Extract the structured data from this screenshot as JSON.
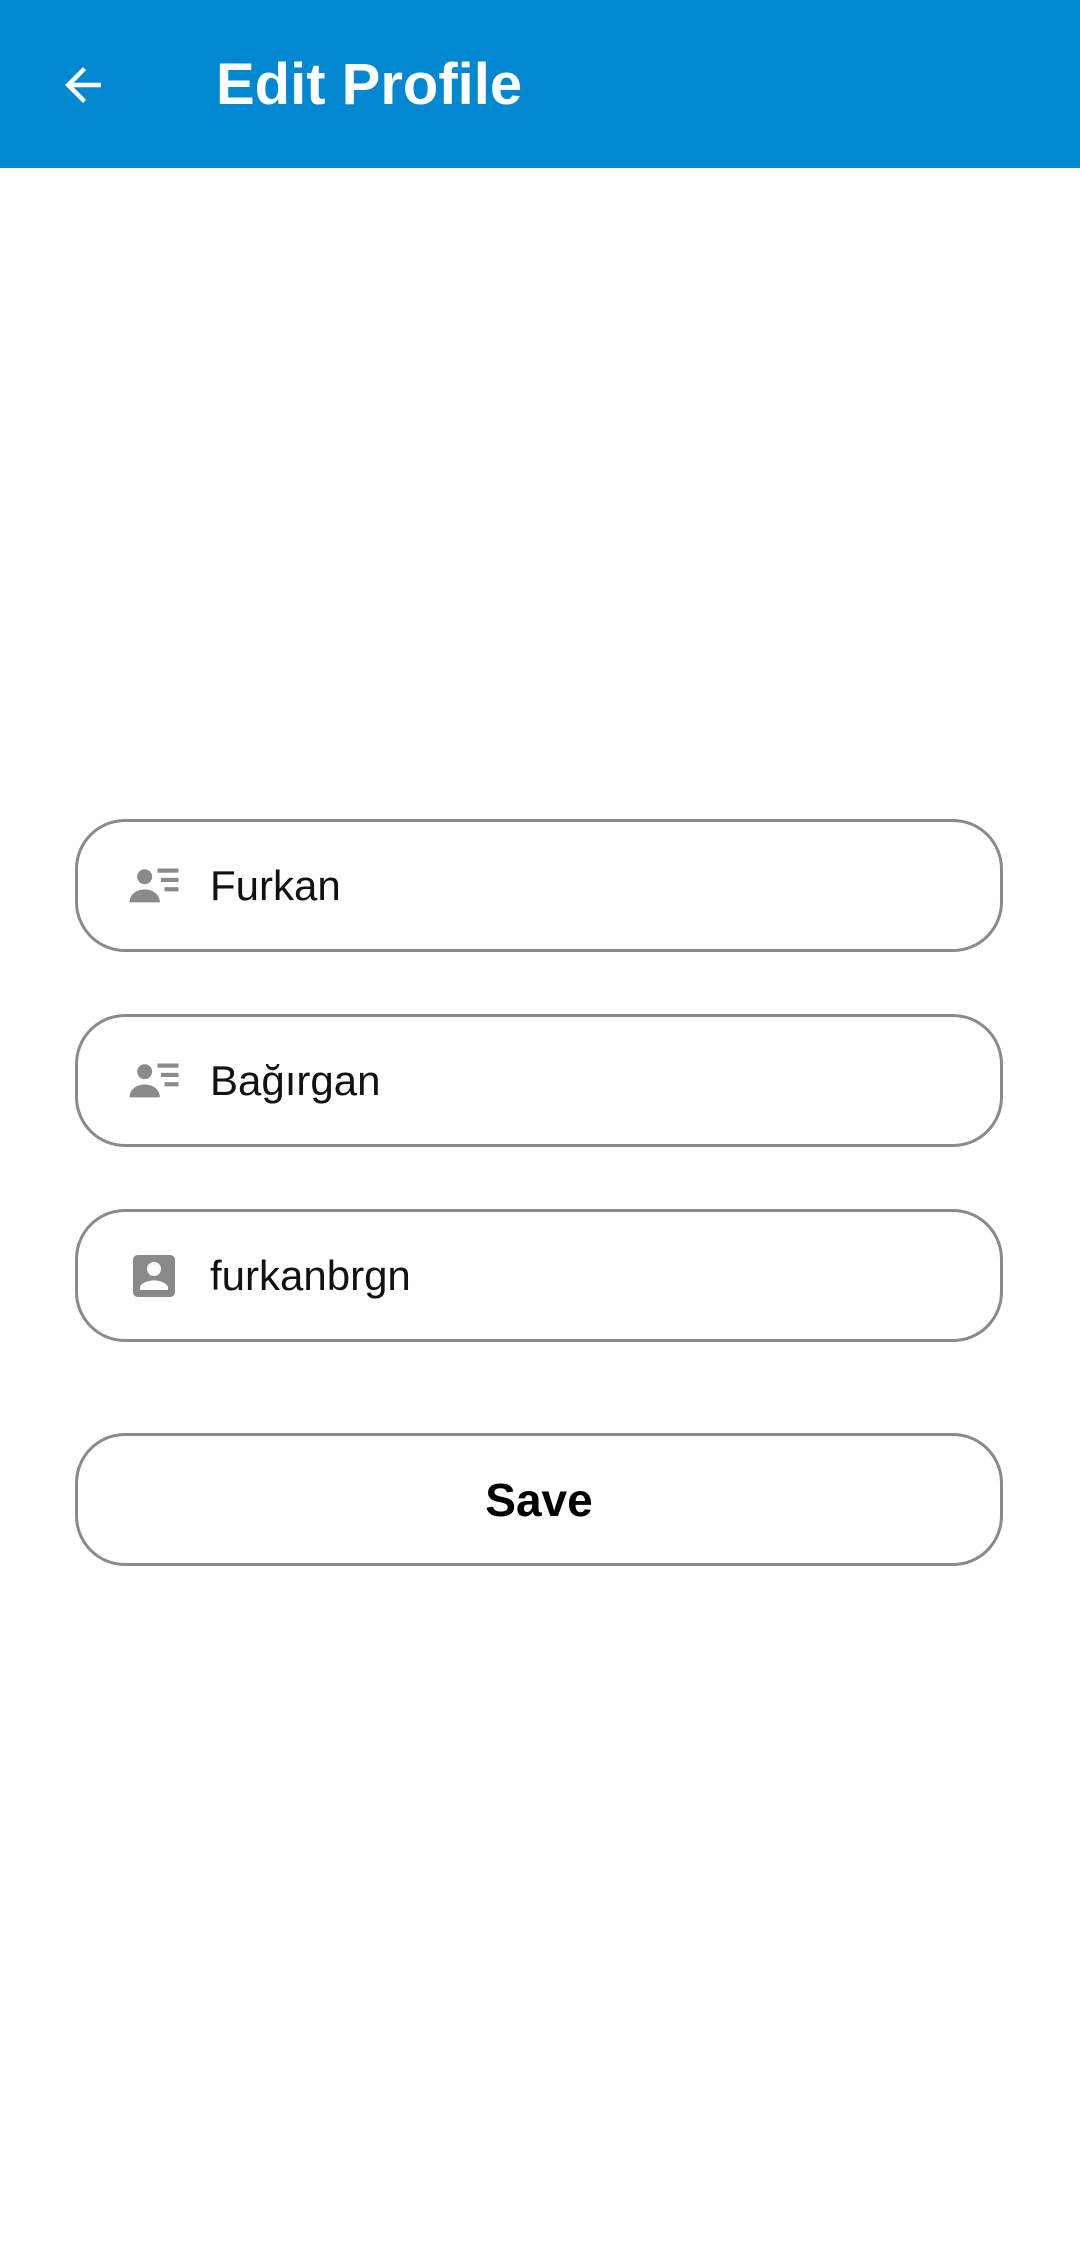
{
  "app_bar": {
    "title": "Edit Profile",
    "back_icon": "arrow-back-icon",
    "background_color": "#0288D1"
  },
  "form": {
    "first_name": {
      "value": "Furkan",
      "icon": "contact-list-icon"
    },
    "last_name": {
      "value": "Bağırgan",
      "icon": "contact-list-icon"
    },
    "username": {
      "value": "furkanbrgn",
      "icon": "account-box-icon"
    },
    "save_label": "Save"
  },
  "colors": {
    "icon": "#8a8a8a",
    "border": "#8a8a8a",
    "text": "#111111"
  }
}
